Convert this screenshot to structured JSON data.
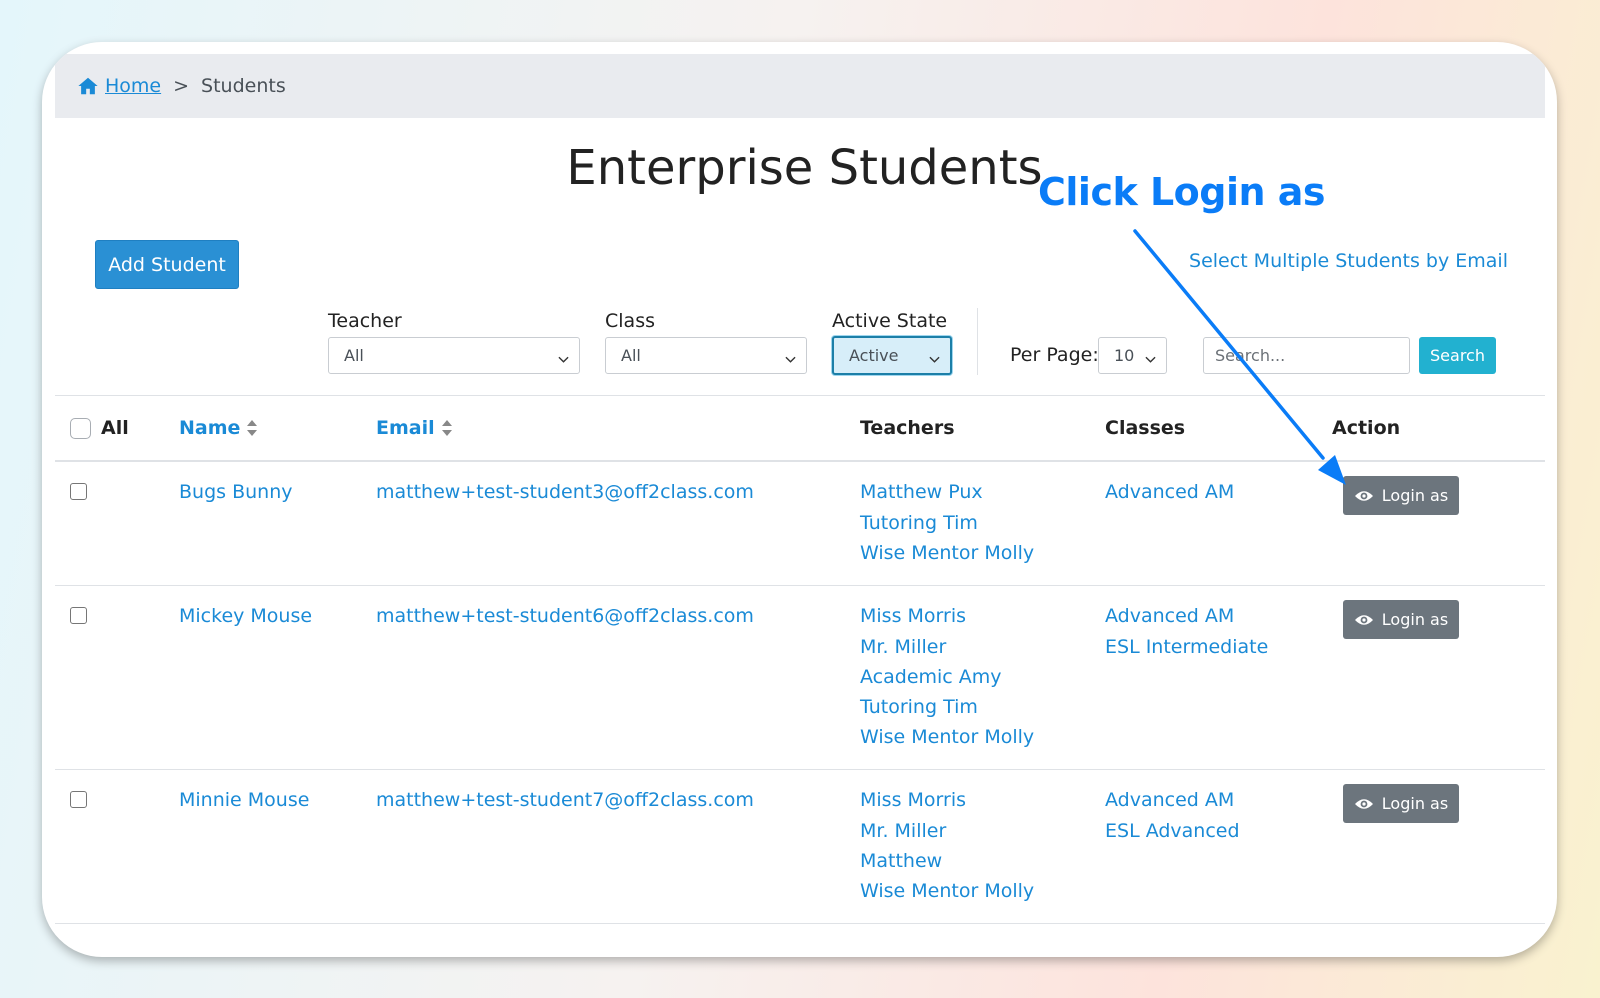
{
  "breadcrumb": {
    "home": "Home",
    "separator": ">",
    "current": "Students"
  },
  "page": {
    "title": "Enterprise Students"
  },
  "actions": {
    "add_student": "Add Student",
    "select_multiple": "Select Multiple Students by Email"
  },
  "filters": {
    "teacher": {
      "label": "Teacher",
      "value": "All"
    },
    "class": {
      "label": "Class",
      "value": "All"
    },
    "active_state": {
      "label": "Active State",
      "value": "Active"
    },
    "per_page": {
      "label": "Per Page:",
      "value": "10"
    },
    "search": {
      "placeholder": "Search...",
      "button": "Search"
    }
  },
  "table": {
    "headers": {
      "all": "All",
      "name": "Name",
      "email": "Email",
      "teachers": "Teachers",
      "classes": "Classes",
      "action": "Action"
    },
    "rows": [
      {
        "name": "Bugs Bunny",
        "email": "matthew+test-student3@off2class.com",
        "teachers": [
          "Matthew Pux",
          "Tutoring Tim",
          "Wise Mentor Molly"
        ],
        "classes": [
          "Advanced AM"
        ],
        "action": "Login as"
      },
      {
        "name": "Mickey Mouse",
        "email": "matthew+test-student6@off2class.com",
        "teachers": [
          "Miss Morris",
          "Mr. Miller",
          "Academic Amy",
          "Tutoring Tim",
          "Wise Mentor Molly"
        ],
        "classes": [
          "Advanced AM",
          "ESL Intermediate"
        ],
        "action": "Login as"
      },
      {
        "name": "Minnie Mouse",
        "email": "matthew+test-student7@off2class.com",
        "teachers": [
          "Miss Morris",
          "Mr. Miller",
          "Matthew",
          "Wise Mentor Molly"
        ],
        "classes": [
          "Advanced AM",
          "ESL Advanced"
        ],
        "action": "Login as"
      }
    ]
  },
  "annotation": {
    "text": "Click Login as",
    "color": "#0a7cf7"
  },
  "colors": {
    "link": "#1a8ad6",
    "primary": "#2a90d4",
    "search": "#22b1d0",
    "secondary": "#6c757d"
  },
  "icons": {
    "home": "home-icon",
    "sort": "sort-icon",
    "chevron": "chevron-down-icon",
    "eye": "eye-icon"
  }
}
